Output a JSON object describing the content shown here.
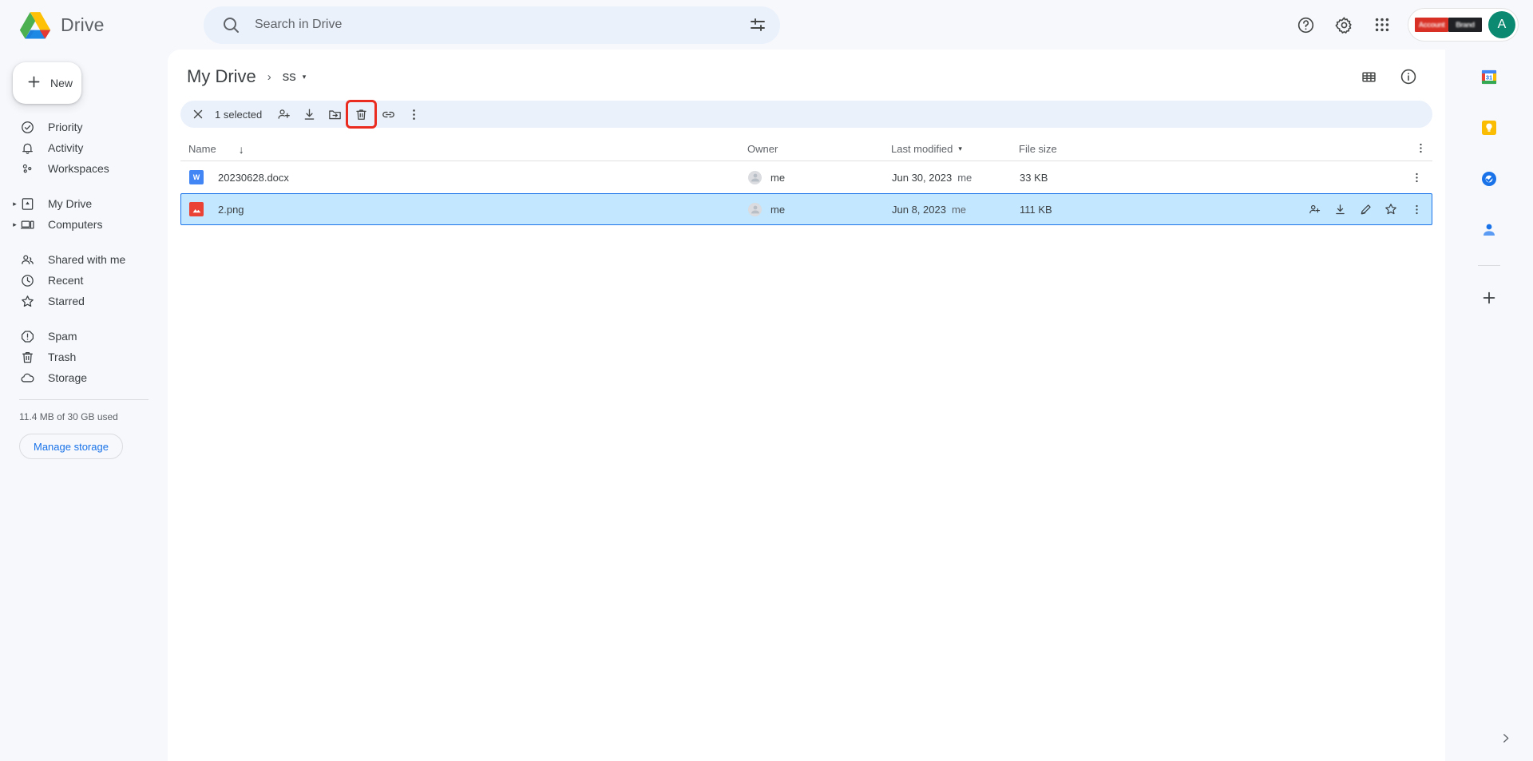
{
  "app": {
    "brand": "Drive",
    "logo_icon": "drive-triangle-logo"
  },
  "search": {
    "placeholder": "Search in Drive",
    "value": "",
    "search_icon": "search-icon",
    "tune_icon": "tune-filter-icon"
  },
  "header_actions": {
    "help_icon": "help-circle-icon",
    "settings_icon": "gear-icon",
    "apps_icon": "apps-grid-icon",
    "badge_left_text": "Account",
    "badge_right_text": "Brand",
    "avatar_initial": "A",
    "avatar_color": "#0b8a71"
  },
  "sidebar": {
    "new_button": "New",
    "new_icon": "plus-icon",
    "groups": [
      {
        "items": [
          {
            "label": "Priority",
            "icon": "check-circle-icon",
            "caret": false
          },
          {
            "label": "Activity",
            "icon": "bell-icon",
            "caret": false
          },
          {
            "label": "Workspaces",
            "icon": "workspaces-icon",
            "caret": false
          }
        ]
      },
      {
        "items": [
          {
            "label": "My Drive",
            "icon": "my-drive-icon",
            "caret": true
          },
          {
            "label": "Computers",
            "icon": "computers-icon",
            "caret": true
          }
        ]
      },
      {
        "items": [
          {
            "label": "Shared with me",
            "icon": "people-icon",
            "caret": false
          },
          {
            "label": "Recent",
            "icon": "clock-icon",
            "caret": false
          },
          {
            "label": "Starred",
            "icon": "star-icon",
            "caret": false
          }
        ]
      },
      {
        "items": [
          {
            "label": "Spam",
            "icon": "spam-icon",
            "caret": false
          },
          {
            "label": "Trash",
            "icon": "trash-icon",
            "caret": false
          },
          {
            "label": "Storage",
            "icon": "cloud-icon",
            "caret": false
          }
        ]
      }
    ],
    "storage_text": "11.4 MB of 30 GB used",
    "manage_storage": "Manage storage"
  },
  "main": {
    "breadcrumb": {
      "root": "My Drive",
      "separator": "›",
      "current": "ss",
      "caret": "▾"
    },
    "view_toggle_icon": "grid-view-icon",
    "info_icon": "info-circle-icon",
    "toolbar": {
      "close_icon": "close-x-icon",
      "selected_label": "1 selected",
      "share_icon": "person-add-icon",
      "download_icon": "download-icon",
      "move_icon": "move-to-folder-icon",
      "trash_icon": "trash-icon",
      "link_icon": "link-icon",
      "more_icon": "more-vertical-icon",
      "highlighted_action": "trash-icon",
      "highlight_color": "#ea2b1f"
    },
    "table": {
      "columns": {
        "name": "Name",
        "name_sort_icon": "↓",
        "owner": "Owner",
        "last_modified": "Last modified",
        "last_modified_caret": "▾",
        "file_size": "File size",
        "more_icon": "more-vertical-icon"
      },
      "rows": [
        {
          "name": "20230628.docx",
          "icon": "word-doc-icon",
          "icon_letter": "W",
          "owner": "me",
          "last_modified_date": "Jun 30, 2023",
          "last_modified_by": "me",
          "file_size": "33 KB",
          "selected": false,
          "show_actions": false
        },
        {
          "name": "2.png",
          "icon": "image-file-icon",
          "icon_letter": "",
          "owner": "me",
          "last_modified_date": "Jun 8, 2023",
          "last_modified_by": "me",
          "file_size": "111 KB",
          "selected": true,
          "show_actions": true
        }
      ],
      "row_actions": {
        "share_icon": "person-add-icon",
        "download_icon": "download-icon",
        "edit_icon": "pencil-icon",
        "star_icon": "star-outline-icon",
        "more_icon": "more-vertical-icon"
      }
    }
  },
  "rail": {
    "items": [
      {
        "name": "calendar-icon",
        "label": "Calendar",
        "day": "31"
      },
      {
        "name": "keep-icon",
        "label": "Keep"
      },
      {
        "name": "tasks-icon",
        "label": "Tasks"
      },
      {
        "name": "contacts-icon",
        "label": "Contacts"
      }
    ],
    "add_icon": "plus-icon",
    "expand_icon": "chevron-right-icon"
  }
}
